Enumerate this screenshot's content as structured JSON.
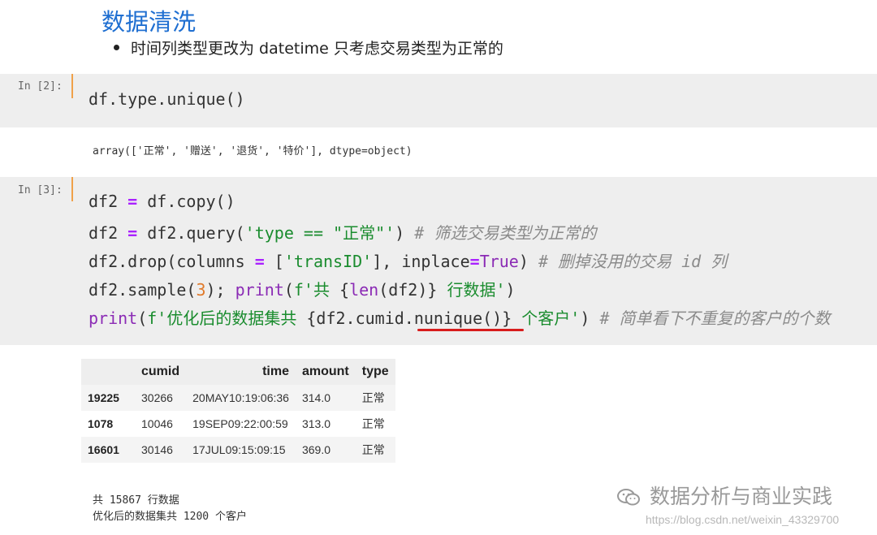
{
  "heading": "数据清洗",
  "bullet": "时间列类型更改为 datetime 只考虑交易类型为正常的",
  "cell2": {
    "prompt": "In [2]:",
    "code": "df.type.unique()",
    "output": "array(['正常', '赠送', '退货', '特价'], dtype=object)"
  },
  "cell3": {
    "prompt": "In [3]:",
    "line1": {
      "a": "df2 ",
      "eq": "=",
      "b": " df.copy()"
    },
    "line2": {
      "a": "df2 ",
      "eq": "=",
      "b": " df2.query(",
      "s": "'type == \"正常\"'",
      "c": ") ",
      "comment": "# 筛选交易类型为正常的"
    },
    "line3": {
      "a": "df2.drop(columns ",
      "eq": "=",
      "b": " [",
      "s": "'transID'",
      "c": "], inplace",
      "eq2": "=",
      "kw": "True",
      "d": ") ",
      "comment": "# 删掉没用的交易 id 列"
    },
    "line4": {
      "a": "df2.sample(",
      "n": "3",
      "b": "); ",
      "kw": "print",
      "c": "(",
      "s1": "f'共 ",
      "e": "{",
      "kw2": "len",
      "f": "(df2)",
      "g": "}",
      "s2": " 行数据'",
      "h": ")"
    },
    "line5": {
      "kw": "print",
      "a": "(",
      "s1": "f'优化后的数据集共 ",
      "e": "{df2.cumid.",
      "u": "nunique()",
      "g": "}",
      "s2": " 个客户'",
      "h": ") ",
      "comment": "# 简单看下不重复的客户的个数"
    }
  },
  "table": {
    "columns": [
      "",
      "cumid",
      "time",
      "amount",
      "type"
    ],
    "rows": [
      {
        "index": "19225",
        "cumid": "30266",
        "time": "20MAY10:19:06:36",
        "amount": "314.0",
        "type": "正常"
      },
      {
        "index": "1078",
        "cumid": "10046",
        "time": "19SEP09:22:00:59",
        "amount": "313.0",
        "type": "正常"
      },
      {
        "index": "16601",
        "cumid": "30146",
        "time": "17JUL09:15:09:15",
        "amount": "369.0",
        "type": "正常"
      }
    ]
  },
  "print_output": {
    "line1": "共 15867 行数据",
    "line2": "优化后的数据集共 1200 个客户"
  },
  "watermark": {
    "text": "数据分析与商业实践",
    "url": "https://blog.csdn.net/weixin_43329700",
    "icon": "wechat-icon"
  },
  "colors": {
    "heading": "#1f6fd1",
    "cell_bg": "#eeeeee",
    "cell_bar": "#f0a14a",
    "string": "#1a8c2e",
    "keyword": "#8b2bb5",
    "number": "#e07a2b",
    "comment": "#8a8a8a",
    "annotation_underline": "#d81c1c"
  }
}
